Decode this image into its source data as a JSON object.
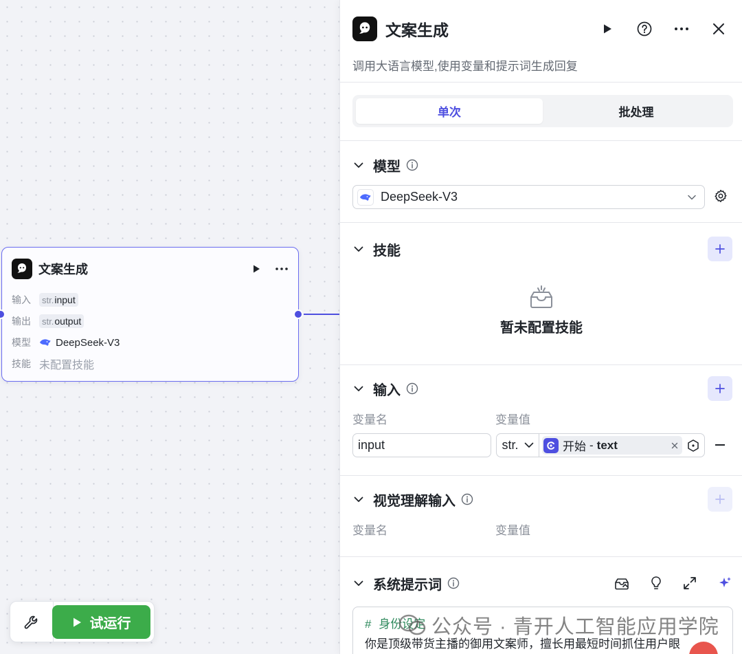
{
  "node": {
    "title": "文案生成",
    "rows": {
      "input_label": "输入",
      "input_type": "str.",
      "input_name": "input",
      "output_label": "输出",
      "output_type": "str.",
      "output_name": "output",
      "model_label": "模型",
      "model_value": "DeepSeek-V3",
      "skill_label": "技能",
      "skill_value": "未配置技能"
    }
  },
  "toolbar": {
    "tool_icon": "wrench-icon",
    "run_label": "试运行",
    "run_color": "#3cac4a"
  },
  "panel": {
    "title": "文案生成",
    "description": "调用大语言模型,使用变量和提示词生成回复",
    "tabs": [
      {
        "label": "单次",
        "active": true
      },
      {
        "label": "批处理",
        "active": false
      }
    ],
    "model_section": {
      "title": "模型",
      "selected": "DeepSeek-V3"
    },
    "skills_section": {
      "title": "技能",
      "empty_text": "暂未配置技能"
    },
    "input_section": {
      "title": "输入",
      "col_name": "变量名",
      "col_value": "变量值",
      "rows": [
        {
          "name": "input",
          "type": "str.",
          "ref_node": "开始",
          "ref_sep": "-",
          "ref_var": "text"
        }
      ]
    },
    "vision_section": {
      "title": "视觉理解输入",
      "col_name": "变量名",
      "col_value": "变量值"
    },
    "system_prompt": {
      "title": "系统提示词",
      "heading_hash": "#",
      "heading": "身份设定",
      "body": "你是顶级带货主播的御用文案师，擅长用最短时间抓住用户眼"
    }
  },
  "watermark": {
    "text": "公众号 · 青开人工智能应用学院"
  },
  "colors": {
    "accent": "#4e4fe0",
    "accent_soft": "#e6e8fd",
    "prompt_heading": "#2f8a5d"
  }
}
